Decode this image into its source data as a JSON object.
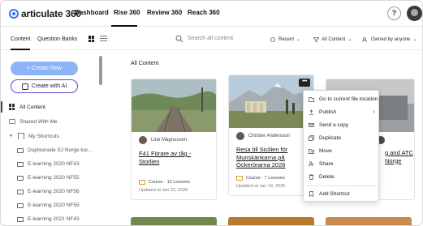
{
  "brand": {
    "logo_text": "articulate 360"
  },
  "topnav": {
    "tabs": [
      "Dashboard",
      "Rise 360",
      "Review 360",
      "Reach 360"
    ],
    "active_tab": "Rise 360",
    "help_label": "?"
  },
  "toolbar": {
    "tabs": [
      "Content",
      "Question Banks"
    ],
    "active_tab": "Content",
    "search_placeholder": "Search all content",
    "sort_label": "Recent",
    "filter_content_label": "All Content",
    "filter_owner_label": "Owned by anyone"
  },
  "sidebar": {
    "create_new_label": "+ Create New",
    "create_ai_label": "Create with AI",
    "items": [
      {
        "label": "All Content",
        "icon": "grid-icon",
        "active": true
      },
      {
        "label": "Shared With Me",
        "icon": "shared-icon",
        "active": false
      },
      {
        "label": "My Shortcuts",
        "icon": "bookmark-icon",
        "active": false
      },
      {
        "label": "Duplicerade SJ Norge kur...",
        "icon": "folder-icon",
        "active": false
      },
      {
        "label": "E-learning 2020 NF43",
        "icon": "folder-icon",
        "active": false
      },
      {
        "label": "E-learning 2020 NF55",
        "icon": "folder-icon",
        "active": false
      },
      {
        "label": "E-learning 2020 NF56",
        "icon": "folder-icon",
        "active": false
      },
      {
        "label": "E-learning 2020 NF59",
        "icon": "folder-icon",
        "active": false
      },
      {
        "label": "E-learning 2021 NF43",
        "icon": "folder-icon",
        "active": false
      }
    ]
  },
  "main": {
    "heading": "All Content",
    "cards": [
      {
        "author": "Line Magnussen",
        "title": "F41 Förare av tåg - Storlien",
        "meta": "Course · 13 Lessons",
        "updated": "Updated at Jan 22, 2026"
      },
      {
        "author": "Christer Andersson",
        "title": "Resa till Sicilien för Munskänkarna på Öckerörarna 2026",
        "meta": "Course · 7 Lessons",
        "updated": "Updated at Jan 19, 2026",
        "more_label": "•••"
      },
      {
        "author": "",
        "title_partial_top": "g and ATC",
        "title_partial_bottom": "Norge"
      }
    ]
  },
  "context_menu": {
    "items": [
      {
        "label": "Go to current file location",
        "icon": "location-icon"
      },
      {
        "label": "Publish",
        "icon": "upload-icon",
        "has_submenu": true
      },
      {
        "label": "Send a copy",
        "icon": "send-icon"
      },
      {
        "label": "Duplicate",
        "icon": "duplicate-icon"
      },
      {
        "label": "Move",
        "icon": "move-icon"
      },
      {
        "label": "Share",
        "icon": "share-icon"
      },
      {
        "label": "Delete",
        "icon": "trash-icon"
      },
      {
        "label": "Add Shortcut",
        "icon": "bookmark-icon"
      }
    ]
  },
  "colors": {
    "accent_blue": "#3b74f0",
    "create_new_bg": "#8db4f5",
    "ai_border": "#6a3fd9"
  }
}
